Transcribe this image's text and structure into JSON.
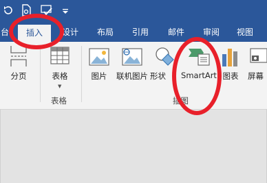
{
  "qat": {
    "undo_icon": "undo-icon",
    "new_doc_icon": "new-document-icon",
    "spell_icon": "spellcheck-icon",
    "customize_icon": "customize-qat-icon"
  },
  "tabs": [
    {
      "label": "台",
      "active": false
    },
    {
      "label": "插入",
      "active": true
    },
    {
      "label": "设计",
      "active": false
    },
    {
      "label": "布局",
      "active": false
    },
    {
      "label": "引用",
      "active": false
    },
    {
      "label": "邮件",
      "active": false
    },
    {
      "label": "审阅",
      "active": false
    },
    {
      "label": "视图",
      "active": false
    }
  ],
  "ribbon": {
    "page_break_label": "分页",
    "table_label": "表格",
    "table_group_label": "表格",
    "picture_label": "图片",
    "online_picture_label": "联机图片",
    "shapes_label": "形状",
    "smartart_label": "SmartArt",
    "chart_label": "图表",
    "screenshot_label": "屏幕",
    "illustrations_group_label": "插图"
  },
  "colors": {
    "title_bar": "#2b579a",
    "ribbon_bg": "#f3f3f3",
    "annotation": "#e8202a"
  }
}
